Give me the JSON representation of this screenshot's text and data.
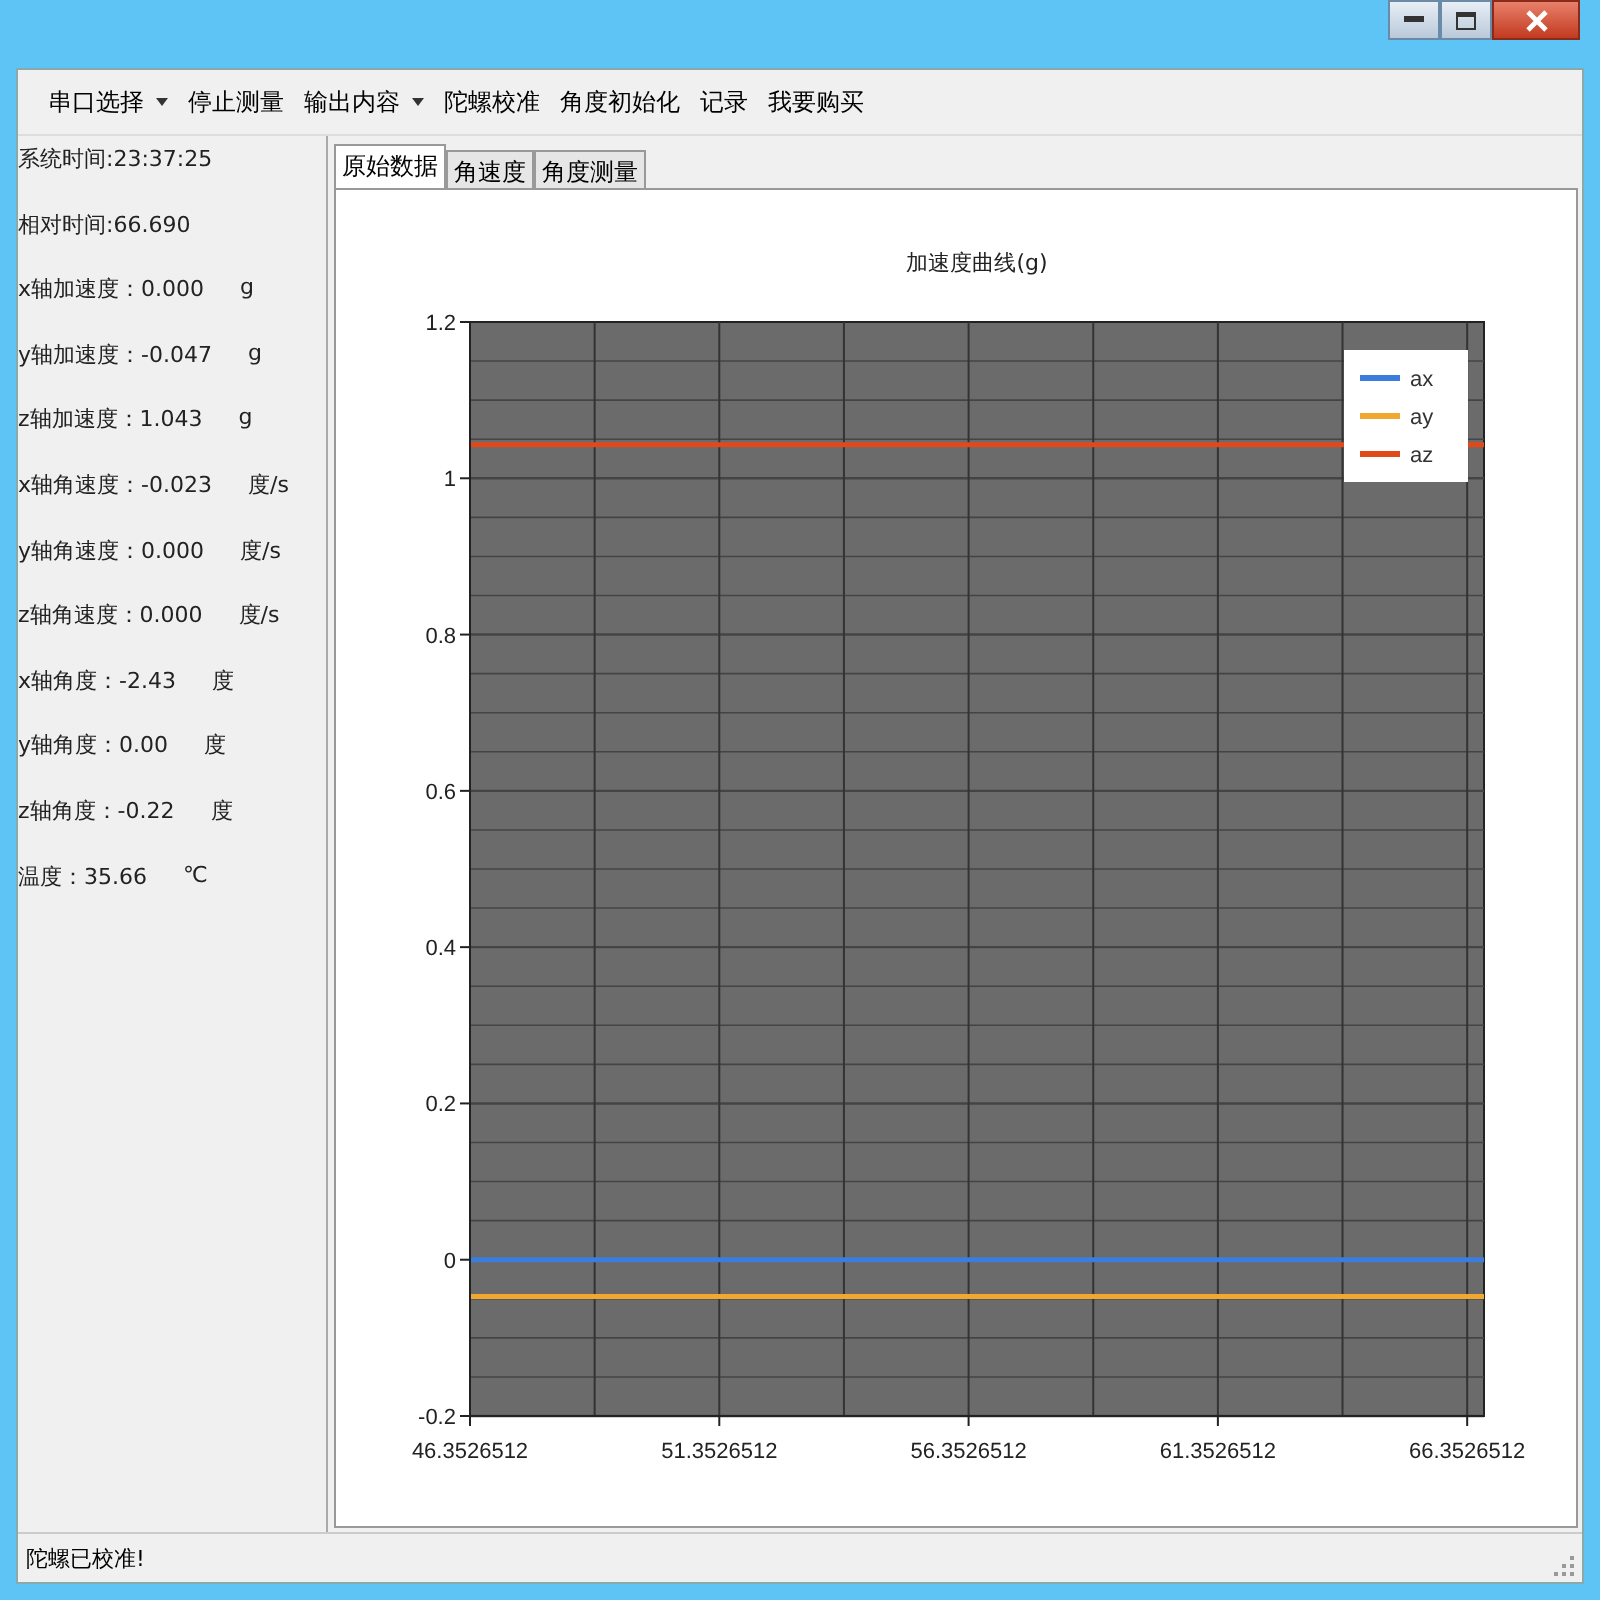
{
  "menu": [
    {
      "label": "串口选择",
      "dropdown": true
    },
    {
      "label": "停止测量",
      "dropdown": false
    },
    {
      "label": "输出内容",
      "dropdown": true
    },
    {
      "label": "陀螺校准",
      "dropdown": false
    },
    {
      "label": "角度初始化",
      "dropdown": false
    },
    {
      "label": "记录",
      "dropdown": false
    },
    {
      "label": "我要购买",
      "dropdown": false
    }
  ],
  "readings": [
    {
      "text": "系统时间:23:37:25"
    },
    {
      "text": "相对时间:66.690"
    },
    {
      "text": "x轴加速度：0.000",
      "unit": "g"
    },
    {
      "text": "y轴加速度：-0.047",
      "unit": "g"
    },
    {
      "text": "z轴加速度：1.043",
      "unit": "g"
    },
    {
      "text": "x轴角速度：-0.023",
      "unit": "度/s"
    },
    {
      "text": "y轴角速度：0.000",
      "unit": "度/s"
    },
    {
      "text": "z轴角速度：0.000",
      "unit": "度/s"
    },
    {
      "text": "x轴角度：-2.43",
      "unit": "度"
    },
    {
      "text": "y轴角度：0.00",
      "unit": "度"
    },
    {
      "text": "z轴角度：-0.22",
      "unit": "度"
    },
    {
      "text": "温度：35.66",
      "unit": "℃"
    }
  ],
  "tabs": [
    {
      "label": "原始数据",
      "selected": true
    },
    {
      "label": "角速度",
      "selected": false
    },
    {
      "label": "角度测量",
      "selected": false
    }
  ],
  "chart_data": {
    "type": "line",
    "title": "加速度曲线(g)",
    "x": [
      46.3526512,
      66.69
    ],
    "xlim": [
      46.3526512,
      66.69
    ],
    "grid": true,
    "legend": true,
    "ylim": [
      -0.2,
      1.2
    ],
    "xticks": [
      {
        "value": 46.3526512,
        "label": "46.3526512"
      },
      {
        "value": 51.3526512,
        "label": "51.3526512"
      },
      {
        "value": 56.3526512,
        "label": "56.3526512"
      },
      {
        "value": 61.3526512,
        "label": "61.3526512"
      },
      {
        "value": 66.3526512,
        "label": "66.3526512"
      }
    ],
    "yticks": [
      {
        "value": -0.2,
        "label": "-0.2"
      },
      {
        "value": 0,
        "label": "0"
      },
      {
        "value": 0.2,
        "label": "0.2"
      },
      {
        "value": 0.4,
        "label": "0.4"
      },
      {
        "value": 0.6,
        "label": "0.6"
      },
      {
        "value": 0.8,
        "label": "0.8"
      },
      {
        "value": 1,
        "label": "1"
      },
      {
        "value": 1.2,
        "label": "1.2"
      }
    ],
    "series": [
      {
        "name": "ax",
        "color": "#3b7ddd",
        "values": [
          0,
          0
        ]
      },
      {
        "name": "ay",
        "color": "#f0a830",
        "values": [
          -0.047,
          -0.047
        ]
      },
      {
        "name": "az",
        "color": "#e04a1a",
        "values": [
          1.043,
          1.043
        ]
      }
    ]
  },
  "status_bar": "陀螺已校准!"
}
